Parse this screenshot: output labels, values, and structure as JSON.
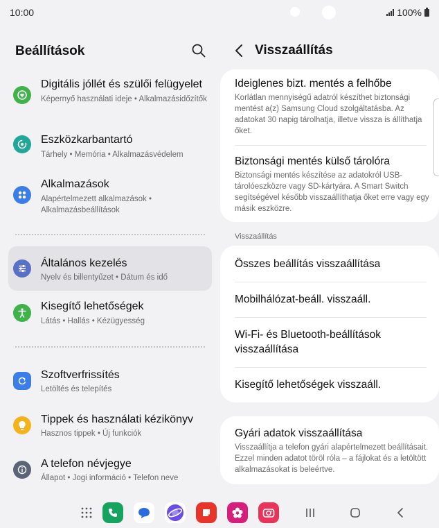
{
  "status_bar": {
    "time": "10:00",
    "battery": "100%"
  },
  "left": {
    "title": "Beállítások",
    "items": [
      {
        "label": "Digitális jóllét és szülői felügyelet",
        "sub": "Képernyő használati ideje  •  Alkalmazásidőzítők",
        "icon": "heart-circle-icon",
        "color": "#3fb24a"
      },
      {
        "label": "Eszközkarbantartó",
        "sub": "Tárhely  •  Memória  •  Alkalmazásvédelem",
        "icon": "device-care-icon",
        "color": "#1fa89a"
      },
      {
        "label": "Alkalmazások",
        "sub": "Alapértelmezett alkalmazások  •  Alkalmazásbeállítások",
        "icon": "apps-grid-icon",
        "color": "#3b7ee8"
      },
      {
        "label": "Általános kezelés",
        "sub": "Nyelv és billentyűzet  •  Dátum és idő",
        "icon": "sliders-icon",
        "color": "#5a6fc6"
      },
      {
        "label": "Kisegítő lehetőségek",
        "sub": "Látás  •  Hallás  •  Kézügyesség",
        "icon": "accessibility-icon",
        "color": "#3fb24a"
      },
      {
        "label": "Szoftverfrissítés",
        "sub": "Letöltés és telepítés",
        "icon": "update-icon",
        "color": "#3b7ee8"
      },
      {
        "label": "Tippek és használati kézikönyv",
        "sub": "Hasznos tippek  •  Új funkciók",
        "icon": "lightbulb-icon",
        "color": "#f5b31b"
      },
      {
        "label": "A telefon névjegye",
        "sub": "Állapot  •  Jogi információ  •  Telefon neve",
        "icon": "info-icon",
        "color": "#5b6577"
      }
    ]
  },
  "right": {
    "title": "Visszaállítás",
    "backup_items": [
      {
        "title": "Ideiglenes bizt. mentés a felhőbe",
        "desc": "Korlátlan mennyiségű adatról készíthet biztonsági mentést a(z) Samsung Cloud szolgáltatásba. Az adatokat 30 napig tárolhatja, illetve vissza is állíthatja őket."
      },
      {
        "title": "Biztonsági mentés külső tárolóra",
        "desc": "Biztonsági mentés készítése az adatokról USB-tárolóeszközre vagy SD-kártyára. A Smart Switch segítségével később visszaállíthatja őket erre vagy egy másik eszközre."
      }
    ],
    "section_label": "Visszaállítás",
    "reset_items": [
      "Összes beállítás visszaállítása",
      "Mobilhálózat-beáll. visszaáll.",
      "Wi-Fi- és Bluetooth-beállítások visszaállítása",
      "Kisegítő lehetőségek visszaáll."
    ],
    "factory": {
      "title": "Gyári adatok visszaállítása",
      "desc": "Visszaállítja a telefon gyári alapértelmezett beállításait. Ezzel minden adatot töröl róla – a fájlokat és a letöltött alkalmazásokat is beleértve."
    }
  },
  "dock": {
    "apps": [
      "apps-drawer-icon",
      "phone-icon",
      "messages-icon",
      "internet-icon",
      "notes-icon",
      "gallery-icon",
      "camera-icon"
    ]
  }
}
